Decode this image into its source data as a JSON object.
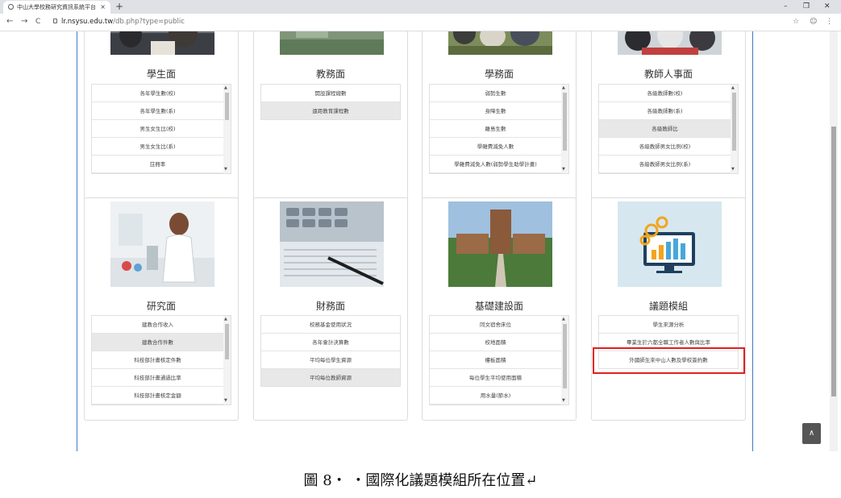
{
  "browser": {
    "tab_title": "中山大學校務研究資訊系統平台",
    "tab_close": "×",
    "new_tab": "+",
    "window": {
      "minimize": "–",
      "restore": "❐",
      "close": "✕"
    },
    "nav": {
      "back": "←",
      "forward": "→",
      "reload": "C"
    },
    "url_host": "lr.nsysu.edu.tw",
    "url_path": "/db.php?type=public",
    "icons": {
      "star": "☆",
      "profile": "☺",
      "menu": "⋮"
    }
  },
  "cards": [
    {
      "heading": "學生面",
      "items": [
        "各年學生數(校)",
        "各年學生數(系)",
        "男生女生比(校)",
        "男生女生比(系)",
        "註冊率"
      ],
      "selected": -1
    },
    {
      "heading": "教務面",
      "items": [
        "開設課程總數",
        "遠距教育課程數"
      ],
      "selected": 1
    },
    {
      "heading": "學務面",
      "items": [
        "弱勢生數",
        "身障生數",
        "離島生數",
        "學雜費減免人數",
        "學雜費減免人數(弱勢學生助學計畫)"
      ],
      "selected": -1
    },
    {
      "heading": "教師人事面",
      "items": [
        "各級教師數(校)",
        "各級教師數(系)",
        "各級教師比",
        "各級教師男女比例(校)",
        "各級教師男女比例(系)"
      ],
      "selected": 2
    },
    {
      "heading": "研究面",
      "items": [
        "建教合作收入",
        "建教合作件數",
        "科技部計畫核定件數",
        "科技部計畫通過比率",
        "科技部計畫核定金額"
      ],
      "selected": 1
    },
    {
      "heading": "財務面",
      "items": [
        "校務基金使用狀況",
        "各年會計決算數",
        "平均每位學生資源",
        "平均每位教師資源"
      ],
      "selected": 3
    },
    {
      "heading": "基礎建設面",
      "items": [
        "同文宿舍床位",
        "校地面積",
        "樓板面積",
        "每位學生平均使用面積",
        "用水量(節水)"
      ],
      "selected": -1
    },
    {
      "heading": "議題模組",
      "items": [
        "學生來源分析",
        "畢業生於六都全職工作者人數與比率",
        "外國師生來中山人數及學校簽約數"
      ],
      "selected": -1
    }
  ],
  "back_to_top": "∧",
  "caption": "圖 8‧ ‧國際化議題模組所在位置↵",
  "colors": {
    "container_border": "#3c7bbf",
    "highlight": "#e02020",
    "selected": "#e8e8e8"
  }
}
